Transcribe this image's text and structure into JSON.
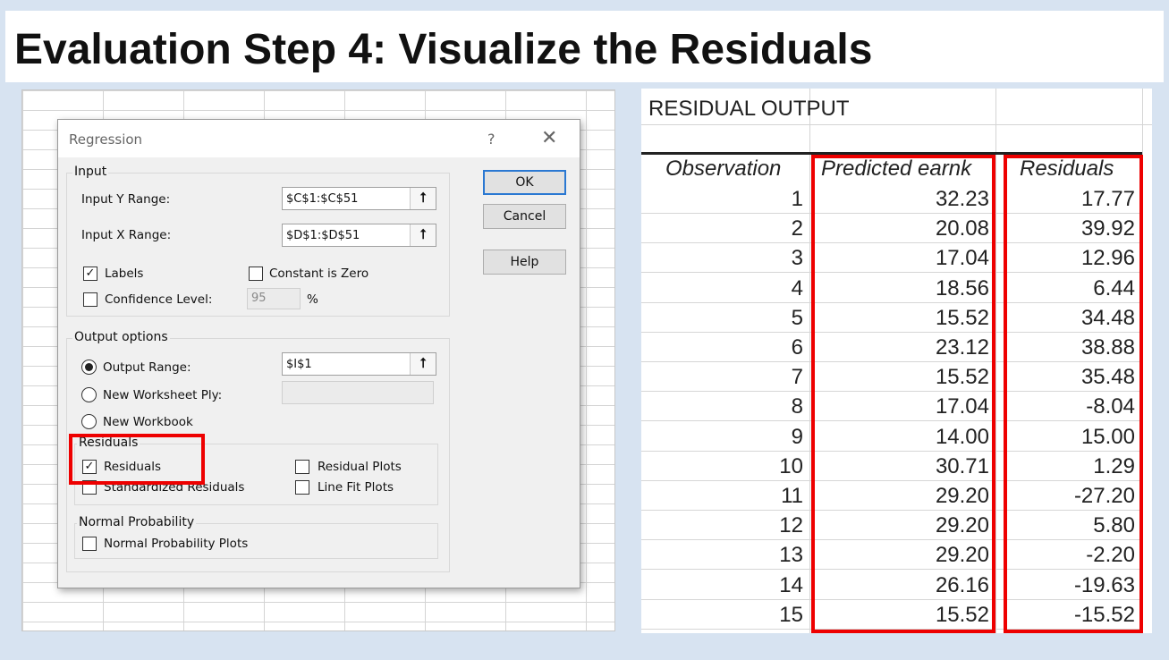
{
  "slide": {
    "title": "Evaluation Step 4: Visualize the Residuals"
  },
  "dialog": {
    "title": "Regression",
    "help_glyph": "?",
    "close_glyph": "✕",
    "ok_label": "OK",
    "cancel_label": "Cancel",
    "help_label": "Help",
    "input": {
      "group_label": "Input",
      "y_range_label": "Input Y Range:",
      "y_range_value": "$C$1:$C$51",
      "x_range_label": "Input X Range:",
      "x_range_value": "$D$1:$D$51",
      "labels_label": "Labels",
      "labels_checked": true,
      "constant_zero_label": "Constant is Zero",
      "confidence_label": "Confidence Level:",
      "confidence_value": "95",
      "percent": "%"
    },
    "output": {
      "group_label": "Output options",
      "output_range_label": "Output Range:",
      "output_range_value": "$I$1",
      "new_worksheet_label": "New Worksheet Ply:",
      "new_workbook_label": "New Workbook"
    },
    "residuals": {
      "group_label": "Residuals",
      "residuals_label": "Residuals",
      "residuals_checked": true,
      "standardized_label": "Standardized Residuals",
      "residual_plots_label": "Residual Plots",
      "line_fit_label": "Line Fit Plots"
    },
    "normal_probability": {
      "group_label": "Normal Probability",
      "plots_label": "Normal Probability Plots"
    }
  },
  "residual_output": {
    "title": "RESIDUAL OUTPUT",
    "headers": [
      "Observation",
      "Predicted earnk",
      "Residuals"
    ],
    "rows": [
      [
        "1",
        "32.23",
        "17.77"
      ],
      [
        "2",
        "20.08",
        "39.92"
      ],
      [
        "3",
        "17.04",
        "12.96"
      ],
      [
        "4",
        "18.56",
        "6.44"
      ],
      [
        "5",
        "15.52",
        "34.48"
      ],
      [
        "6",
        "23.12",
        "38.88"
      ],
      [
        "7",
        "15.52",
        "35.48"
      ],
      [
        "8",
        "17.04",
        "-8.04"
      ],
      [
        "9",
        "14.00",
        "15.00"
      ],
      [
        "10",
        "30.71",
        "1.29"
      ],
      [
        "11",
        "29.20",
        "-27.20"
      ],
      [
        "12",
        "29.20",
        "5.80"
      ],
      [
        "13",
        "29.20",
        "-2.20"
      ],
      [
        "14",
        "26.16",
        "-19.63"
      ],
      [
        "15",
        "15.52",
        "-15.52"
      ]
    ]
  },
  "colors": {
    "highlight": "#ee0000",
    "default_button_border": "#2a78d2",
    "slide_background": "#d7e3f1"
  }
}
